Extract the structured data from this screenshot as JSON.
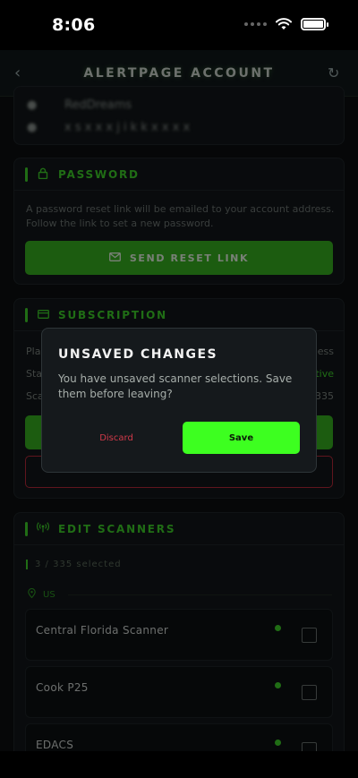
{
  "status_bar": {
    "time": "8:06"
  },
  "header": {
    "title": "ALERTPAGE ACCOUNT",
    "back_icon": "chevron-left-icon",
    "refresh_icon": "refresh-icon"
  },
  "account": {
    "username": "RedDreams",
    "email": "x s x x x j i k k x x x x"
  },
  "password": {
    "title": "PASSWORD",
    "description": "A password reset link will be emailed to your account address. Follow the link to set a new password.",
    "button": "SEND RESET LINK"
  },
  "subscription": {
    "title": "SUBSCRIPTION",
    "rows": [
      {
        "label": "Plan",
        "value": "ess"
      },
      {
        "label": "Status",
        "value": "tive"
      },
      {
        "label": "Scanners",
        "value": "335"
      }
    ]
  },
  "scanners": {
    "title": "EDIT SCANNERS",
    "selected": "3 / 335 selected",
    "region": "US",
    "items": [
      {
        "name": "Central Florida Scanner"
      },
      {
        "name": "Cook P25"
      },
      {
        "name": "EDACS"
      }
    ]
  },
  "modal": {
    "title": "UNSAVED CHANGES",
    "body": "You have unsaved scanner selections. Save them before leaving?",
    "discard": "Discard",
    "save": "Save"
  },
  "colors": {
    "accent": "#3ed12a",
    "save_button": "#3dff20",
    "danger": "#d23a4a",
    "background": "#0c0e10"
  }
}
